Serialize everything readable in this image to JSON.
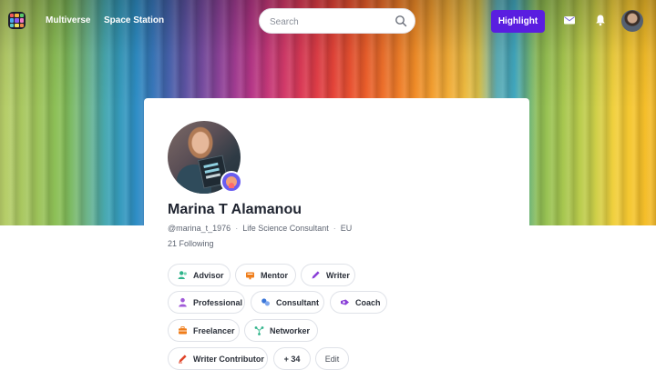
{
  "nav": {
    "links": [
      "Multiverse",
      "Space Station"
    ],
    "search_placeholder": "Search",
    "highlight_label": "Highlight"
  },
  "profile": {
    "name": "Marina T Alamanou",
    "handle": "@marina_t_1976",
    "title": "Life Science Consultant",
    "region": "EU",
    "following": "21 Following"
  },
  "roles": [
    {
      "label": "Advisor",
      "icon": "advisor-icon",
      "color": "#2fb38a"
    },
    {
      "label": "Mentor",
      "icon": "mentor-icon",
      "color": "#ef7d1a"
    },
    {
      "label": "Writer",
      "icon": "writer-icon",
      "color": "#8a3fd8"
    },
    {
      "label": "Professional",
      "icon": "professional-icon",
      "color": "#a05ad8"
    },
    {
      "label": "Consultant",
      "icon": "consultant-icon",
      "color": "#3a76d8"
    },
    {
      "label": "Coach",
      "icon": "coach-icon",
      "color": "#8a3fd8"
    },
    {
      "label": "Freelancer",
      "icon": "freelancer-icon",
      "color": "#ef7d1a"
    },
    {
      "label": "Networker",
      "icon": "networker-icon",
      "color": "#2fb38a"
    },
    {
      "label": "Writer Contributor",
      "icon": "writer-contributor-icon",
      "color": "#e0452a"
    }
  ],
  "roles_more": "+ 34",
  "edit_label": "Edit",
  "colors": {
    "accent": "#5a1ee0",
    "chip_border": "#dfe2e8",
    "text_primary": "#1f2430",
    "text_secondary": "#5f6673"
  }
}
